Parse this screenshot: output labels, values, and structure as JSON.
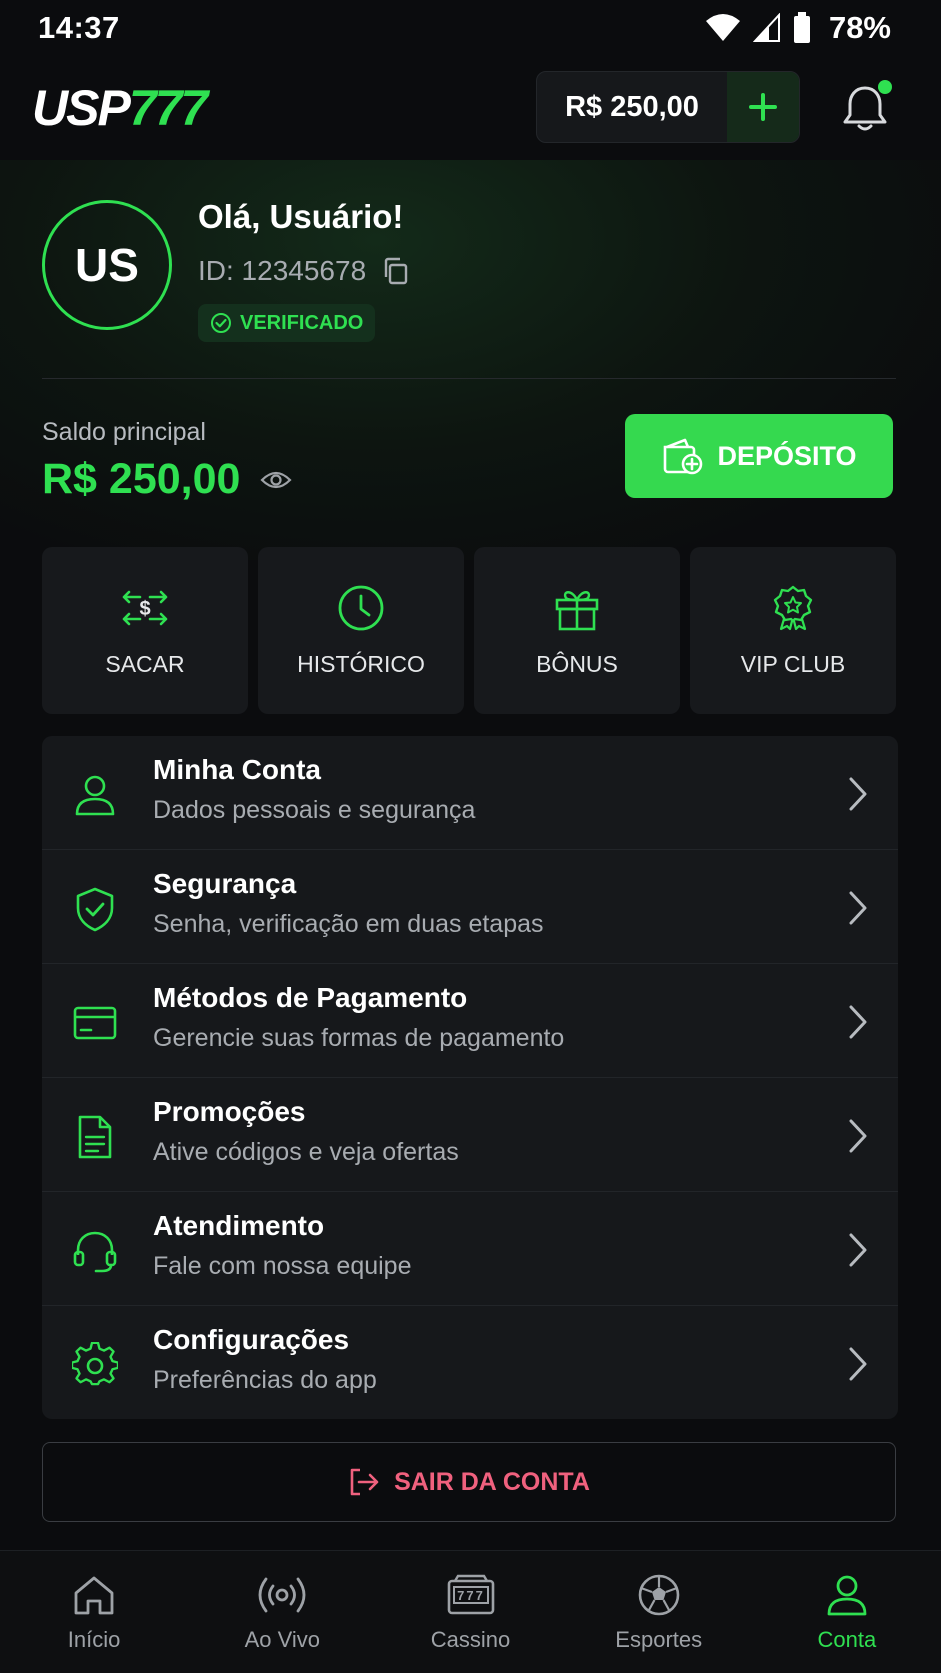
{
  "status_bar": {
    "time": "14:37",
    "battery": "78%"
  },
  "header": {
    "logo_part1": "USP",
    "logo_part2": "777",
    "balance": "R$ 250,00"
  },
  "profile": {
    "initials": "US",
    "greeting": "Olá, Usuário!",
    "user_id": "ID: 12345678",
    "verified_label": "VERIFICADO"
  },
  "balance": {
    "label": "Saldo principal",
    "value": "R$ 250,00",
    "deposit_label": "DEPÓSITO"
  },
  "quick_actions": [
    {
      "label": "SACAR",
      "icon": "transfer-dollar-icon"
    },
    {
      "label": "HISTÓRICO",
      "icon": "clock-icon"
    },
    {
      "label": "BÔNUS",
      "icon": "gift-icon"
    },
    {
      "label": "VIP CLUB",
      "icon": "vip-badge-icon"
    }
  ],
  "menu": [
    {
      "title": "Minha Conta",
      "subtitle": "Dados pessoais e segurança",
      "icon": "user-icon"
    },
    {
      "title": "Segurança",
      "subtitle": "Senha, verificação em duas etapas",
      "icon": "shield-check-icon"
    },
    {
      "title": "Métodos de Pagamento",
      "subtitle": "Gerencie suas formas de pagamento",
      "icon": "credit-card-icon"
    },
    {
      "title": "Promoções",
      "subtitle": "Ative códigos e veja ofertas",
      "icon": "document-icon"
    },
    {
      "title": "Atendimento",
      "subtitle": "Fale com nossa equipe",
      "icon": "headset-icon"
    },
    {
      "title": "Configurações",
      "subtitle": "Preferências do app",
      "icon": "gear-icon"
    }
  ],
  "logout_label": "SAIR DA CONTA",
  "bottom_nav": [
    {
      "label": "Início",
      "icon": "home-icon"
    },
    {
      "label": "Ao Vivo",
      "icon": "live-icon"
    },
    {
      "label": "Cassino",
      "icon": "slot-machine-icon"
    },
    {
      "label": "Esportes",
      "icon": "soccer-ball-icon"
    },
    {
      "label": "Conta",
      "icon": "user-icon",
      "active": true
    }
  ],
  "colors": {
    "accent": "#2fe051",
    "background": "#0b0c0e",
    "card": "#16181b",
    "danger": "#f0617e"
  }
}
